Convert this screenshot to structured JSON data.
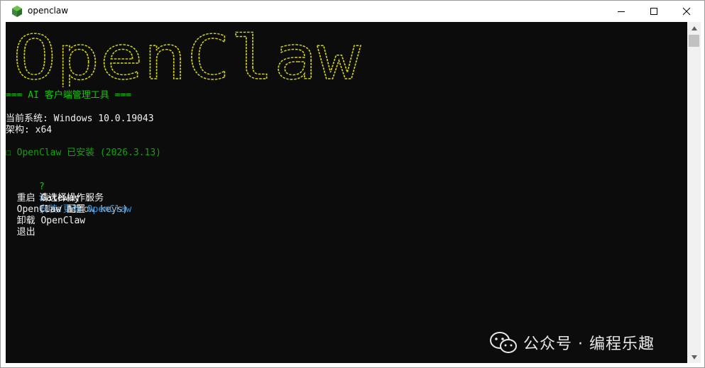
{
  "window": {
    "title": "openclaw",
    "icon": "node-hexagon-icon"
  },
  "console": {
    "banner_text": "OpenClaw",
    "subtitle": "=== AI 客户端管理工具 ===",
    "system_line": "当前系统: Windows 10.0.19043",
    "arch_line": "架构: x64",
    "installed_status": "☐ OpenClaw 已安装 (2026.3.13)",
    "prompt_mark": "?",
    "prompt_text": "请选择操作:",
    "prompt_hint": "(Use arrow keys)",
    "pointer": ">",
    "menu": [
      {
        "label": "安装/更新 OpenClaw",
        "selected": true
      },
      {
        "label": "重启 Gateway 服务",
        "selected": false
      },
      {
        "label": "OpenClaw 配置",
        "selected": false
      },
      {
        "label": "卸载 OpenClaw",
        "selected": false
      },
      {
        "label": "退出",
        "selected": false
      }
    ]
  },
  "watermark": {
    "text": "公众号 · 编程乐趣",
    "icon": "wechat-icon"
  },
  "colors": {
    "console_bg": "#0c0c0c",
    "banner_yellow": "#e5e510",
    "green": "#16c60c",
    "selected_blue": "#3a96dd"
  }
}
